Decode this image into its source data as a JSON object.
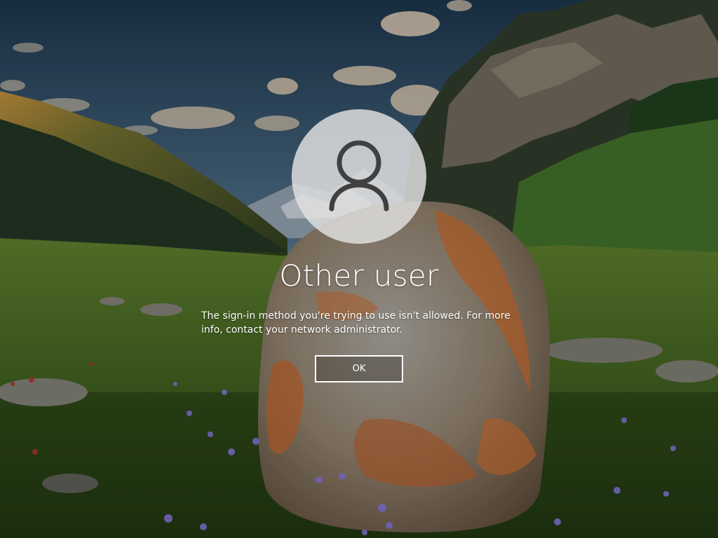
{
  "lock_screen": {
    "account": {
      "avatar_icon": "user-silhouette-icon",
      "name": "Other user"
    },
    "message": "The sign-in method you're trying to use isn't allowed. For more info, contact your network administrator.",
    "ok_label": "OK"
  },
  "colors": {
    "text": "#ffffff",
    "avatar_background": "#e0e0e0",
    "avatar_icon": "#404040",
    "button_border": "#ffffff"
  }
}
